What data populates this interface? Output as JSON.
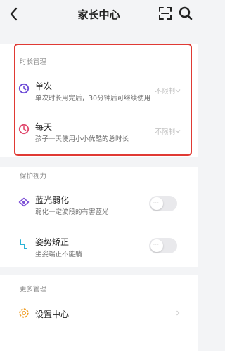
{
  "header": {
    "title": "家长中心",
    "back_icon": "chevron-left-icon",
    "scan_icon": "scan-icon",
    "search_icon": "search-icon"
  },
  "time_management": {
    "section_label": "时长管理",
    "items": [
      {
        "title": "单次",
        "subtitle": "单次时长用完后，30分钟后可继续使用",
        "value": "不限制",
        "icon": "clock-purple-icon",
        "icon_color": "#6c4ad6"
      },
      {
        "title": "每天",
        "subtitle": "孩子一天使用小小优酷的总时长",
        "value": "不限制",
        "icon": "clock-pink-icon",
        "icon_color": "#e14a6e"
      }
    ]
  },
  "eye_protection": {
    "section_label": "保护视力",
    "items": [
      {
        "title": "蓝光弱化",
        "subtitle": "弱化一定波段的有害蓝光",
        "icon": "eye-icon",
        "icon_color": "#7b4dd6",
        "enabled": false
      },
      {
        "title": "姿势矫正",
        "subtitle": "坐姿端正不能躺",
        "icon": "posture-icon",
        "icon_color": "#2bb3d6",
        "enabled": false
      }
    ]
  },
  "more_management": {
    "section_label": "更多管理",
    "items": [
      {
        "title": "设置中心",
        "icon": "settings-gear-icon",
        "icon_color": "#f0a230"
      }
    ]
  },
  "colors": {
    "highlight_border": "#e03a34",
    "background": "#f3f4f6"
  }
}
